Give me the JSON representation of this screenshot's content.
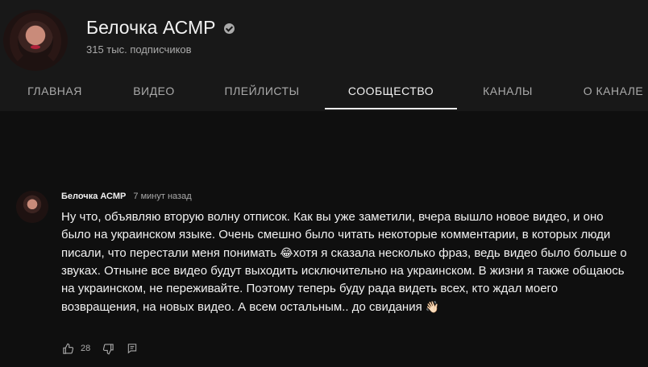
{
  "channel": {
    "name": "Белочка АСМР",
    "subscribers": "315 тыс. подписчиков"
  },
  "tabs": [
    {
      "label": "ГЛАВНАЯ"
    },
    {
      "label": "ВИДЕО"
    },
    {
      "label": "ПЛЕЙЛИСТЫ"
    },
    {
      "label": "СООБЩЕСТВО",
      "active": true
    },
    {
      "label": "КАНАЛЫ"
    },
    {
      "label": "О КАНАЛЕ"
    }
  ],
  "post": {
    "author": "Белочка АСМР",
    "time": "7 минут назад",
    "text_part1": "Ну что, объявляю вторую волну отписок. Как вы уже заметили, вчера вышло новое видео, и оно было на украинском языке. Очень смешно было читать некоторые комментарии, в которых люди писали, что перестали меня понимать",
    "emoji1": "😂",
    "text_part2": "хотя я сказала несколько фраз, ведь видео было больше о звуках. Отныне все видео будут выходить исключительно на украинском. В жизни я также общаюсь на украинском, не переживайте. Поэтому теперь буду рада видеть всех, кто ждал моего возвращения, на новых видео. А всем остальным.. до свидания",
    "emoji2": "👋🏻",
    "likes": "28"
  },
  "icons": {
    "like": "thumbs-up-icon",
    "dislike": "thumbs-down-icon",
    "comment": "comment-icon",
    "verified": "verified-check-icon"
  },
  "colors": {
    "background": "#0f0f0f",
    "header": "#181818",
    "text": "#f1f1f1",
    "secondary_text": "#aaaaaa"
  }
}
